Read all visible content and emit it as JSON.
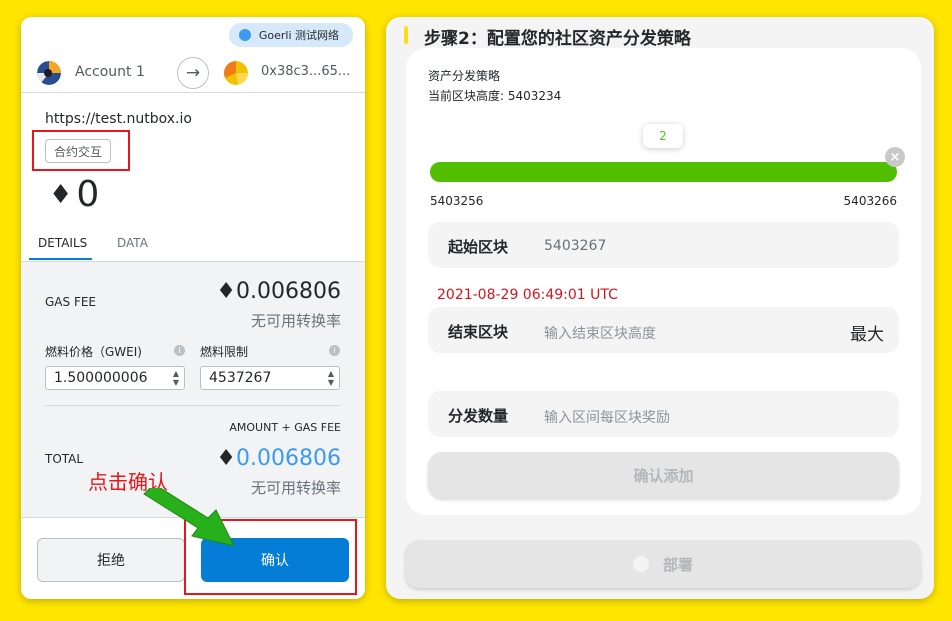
{
  "wallet": {
    "network": "Goerli 测试网络",
    "account_name": "Account 1",
    "to_address": "0x38c3...65...",
    "origin": "https://test.nutbox.io",
    "contract_tag": "合约交互",
    "eth_glyph": "♦",
    "eth_amount": "0",
    "tabs": [
      {
        "label": "DETAILS"
      },
      {
        "label": "DATA"
      }
    ],
    "gas_fee": {
      "label": "GAS FEE",
      "value": "0.006806",
      "sub": "无可用转换率"
    },
    "gas_price": {
      "label": "燃料价格（GWEI)",
      "value": "1.500000006"
    },
    "gas_limit": {
      "label": "燃料限制",
      "value": "4537267"
    },
    "info_glyph": "i",
    "amount_plus_gas_label": "AMOUNT + GAS FEE",
    "total": {
      "label": "TOTAL",
      "value": "0.006806",
      "sub": "无可用转换率"
    },
    "reject_label": "拒绝",
    "confirm_label": "确认",
    "arrow_glyph": "→",
    "spin_up": "▲",
    "spin_down": "▼"
  },
  "annotation": {
    "text": "点击确认",
    "color": "#e8151c"
  },
  "strategy": {
    "step_title": "步骤2：配置您的社区资产分发策略",
    "strategy_label": "资产分发策略",
    "current_height_label": "当前区块高度: 5403234",
    "bubble_value": "2",
    "range_min": "5403256",
    "range_max": "5403266",
    "close_glyph": "×",
    "start_block": {
      "label": "起始区块",
      "value": "5403267"
    },
    "date_text": "2021-08-29 06:49:01 UTC",
    "end_block": {
      "label": "结束区块",
      "placeholder": "输入结束区块高度",
      "max_label": "最大"
    },
    "distribution": {
      "label": "分发数量",
      "placeholder": "输入区间每区块奖励"
    },
    "add_button": "确认添加",
    "deploy_button": "部署"
  },
  "colors": {
    "background": "#ffe600",
    "primary": "#037dd6",
    "progress": "#52be00",
    "highlight": "#e8151c"
  }
}
